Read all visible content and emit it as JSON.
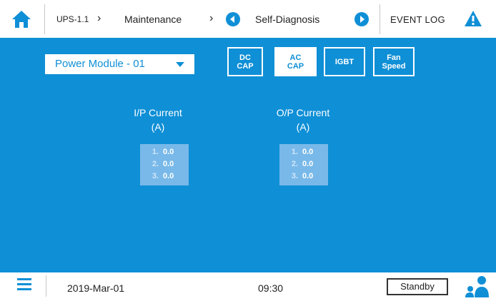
{
  "header": {
    "breadcrumb": {
      "device": "UPS-1.1",
      "section": "Maintenance",
      "page": "Self-Diagnosis"
    },
    "event_log_label": "EVENT LOG"
  },
  "toolbar": {
    "module_select": {
      "selected": "Power Module - 01"
    },
    "tabs": [
      {
        "line1": "DC",
        "line2": "CAP",
        "active": false
      },
      {
        "line1": "AC",
        "line2": "CAP",
        "active": true
      },
      {
        "line1": "IGBT",
        "line2": "",
        "active": false
      },
      {
        "line1": "Fan",
        "line2": "Speed",
        "active": false
      }
    ]
  },
  "readings": {
    "input": {
      "title": "I/P Current",
      "unit": "(A)",
      "rows": [
        {
          "index": "1.",
          "value": "0.0"
        },
        {
          "index": "2.",
          "value": "0.0"
        },
        {
          "index": "3.",
          "value": "0.0"
        }
      ]
    },
    "output": {
      "title": "O/P Current",
      "unit": "(A)",
      "rows": [
        {
          "index": "1.",
          "value": "0.0"
        },
        {
          "index": "2.",
          "value": "0.0"
        },
        {
          "index": "3.",
          "value": "0.0"
        }
      ]
    }
  },
  "footer": {
    "date": "2019-Mar-01",
    "time": "09:30",
    "status": "Standby"
  },
  "colors": {
    "accent": "#0f8fd6",
    "value_box": "#79b9e9",
    "warning": "#0f8fd6"
  },
  "icons": {
    "home": "home-icon",
    "back": "circle-left-icon",
    "forward": "circle-right-icon",
    "warning": "warning-icon",
    "menu": "hamburger-menu-icon",
    "user": "user-icon"
  }
}
